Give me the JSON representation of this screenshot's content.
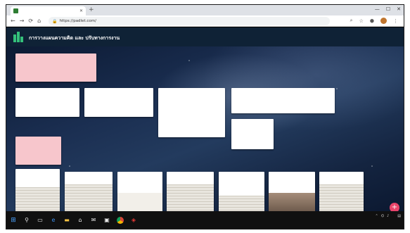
{
  "browser": {
    "tab_title": "",
    "url": "https://padlet.com/"
  },
  "padlet": {
    "author": "",
    "title": "การวางแผนความคิด และ ปรับทางการงาน",
    "subtitle": ""
  },
  "cards": [
    {
      "id": "c1",
      "title": "",
      "body": "",
      "meta": "",
      "pink": true
    },
    {
      "id": "c2",
      "title": "",
      "body": "",
      "meta": ""
    },
    {
      "id": "c3",
      "title": "",
      "body": "",
      "meta": ""
    },
    {
      "id": "c4",
      "title": "",
      "body": "",
      "meta": "",
      "sub": ""
    },
    {
      "id": "c5",
      "title": "",
      "body": "",
      "meta": ""
    },
    {
      "id": "c6",
      "title": "",
      "body": "",
      "meta": ""
    },
    {
      "id": "c7",
      "title": "",
      "body": "",
      "meta": "",
      "pink": true
    },
    {
      "id": "c8",
      "title": "",
      "body": "",
      "thumb": "lined"
    },
    {
      "id": "c9",
      "title": "",
      "body": "",
      "thumb": "lined"
    },
    {
      "id": "c10",
      "title": "",
      "body": "",
      "thumb": "paper"
    },
    {
      "id": "c11",
      "title": "",
      "body": "",
      "thumb": "lined"
    },
    {
      "id": "c12",
      "title": "",
      "body": "",
      "thumb": "lined"
    },
    {
      "id": "c13",
      "title": "",
      "body": "",
      "thumb": "dark"
    },
    {
      "id": "c14",
      "title": "",
      "body": "",
      "thumb": "lined"
    }
  ],
  "taskbar": {
    "time": "",
    "date": ""
  },
  "icons": [
    "windows-icon",
    "search-icon",
    "task-view-icon",
    "edge-icon",
    "file-explorer-icon",
    "store-icon",
    "mail-icon",
    "photos-icon",
    "chrome-icon",
    "acrobat-icon",
    "add-icon"
  ]
}
